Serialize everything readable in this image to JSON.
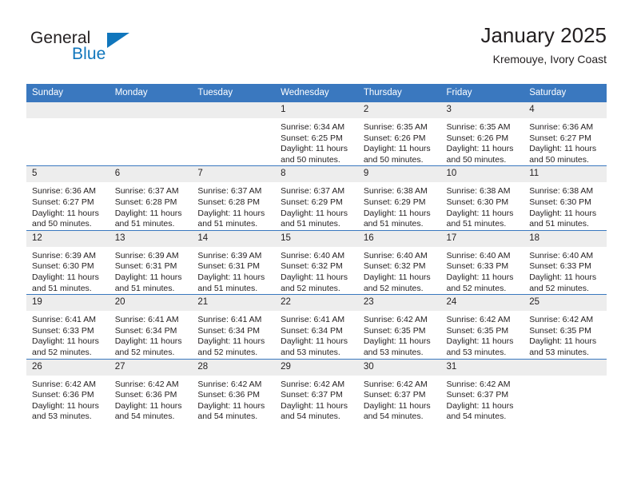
{
  "logo": {
    "word_one": "General",
    "word_two": "Blue",
    "triangle_color": "#1076bc"
  },
  "header": {
    "title": "January 2025",
    "subtitle": "Kremouye, Ivory Coast"
  },
  "theme": {
    "header_blue": "#3a78bf",
    "daynum_gray": "#ededed",
    "text": "#231f20"
  },
  "calendar": {
    "weekday_headers": [
      "Sunday",
      "Monday",
      "Tuesday",
      "Wednesday",
      "Thursday",
      "Friday",
      "Saturday"
    ],
    "labels": {
      "sunrise": "Sunrise:",
      "sunset": "Sunset:",
      "daylight": "Daylight:"
    },
    "weeks": [
      [
        {
          "day": "",
          "empty": true
        },
        {
          "day": "",
          "empty": true
        },
        {
          "day": "",
          "empty": true
        },
        {
          "day": "1",
          "sunrise": "Sunrise: 6:34 AM",
          "sunset": "Sunset: 6:25 PM",
          "daylight": "Daylight: 11 hours and 50 minutes."
        },
        {
          "day": "2",
          "sunrise": "Sunrise: 6:35 AM",
          "sunset": "Sunset: 6:26 PM",
          "daylight": "Daylight: 11 hours and 50 minutes."
        },
        {
          "day": "3",
          "sunrise": "Sunrise: 6:35 AM",
          "sunset": "Sunset: 6:26 PM",
          "daylight": "Daylight: 11 hours and 50 minutes."
        },
        {
          "day": "4",
          "sunrise": "Sunrise: 6:36 AM",
          "sunset": "Sunset: 6:27 PM",
          "daylight": "Daylight: 11 hours and 50 minutes."
        }
      ],
      [
        {
          "day": "5",
          "sunrise": "Sunrise: 6:36 AM",
          "sunset": "Sunset: 6:27 PM",
          "daylight": "Daylight: 11 hours and 50 minutes."
        },
        {
          "day": "6",
          "sunrise": "Sunrise: 6:37 AM",
          "sunset": "Sunset: 6:28 PM",
          "daylight": "Daylight: 11 hours and 51 minutes."
        },
        {
          "day": "7",
          "sunrise": "Sunrise: 6:37 AM",
          "sunset": "Sunset: 6:28 PM",
          "daylight": "Daylight: 11 hours and 51 minutes."
        },
        {
          "day": "8",
          "sunrise": "Sunrise: 6:37 AM",
          "sunset": "Sunset: 6:29 PM",
          "daylight": "Daylight: 11 hours and 51 minutes."
        },
        {
          "day": "9",
          "sunrise": "Sunrise: 6:38 AM",
          "sunset": "Sunset: 6:29 PM",
          "daylight": "Daylight: 11 hours and 51 minutes."
        },
        {
          "day": "10",
          "sunrise": "Sunrise: 6:38 AM",
          "sunset": "Sunset: 6:30 PM",
          "daylight": "Daylight: 11 hours and 51 minutes."
        },
        {
          "day": "11",
          "sunrise": "Sunrise: 6:38 AM",
          "sunset": "Sunset: 6:30 PM",
          "daylight": "Daylight: 11 hours and 51 minutes."
        }
      ],
      [
        {
          "day": "12",
          "sunrise": "Sunrise: 6:39 AM",
          "sunset": "Sunset: 6:30 PM",
          "daylight": "Daylight: 11 hours and 51 minutes."
        },
        {
          "day": "13",
          "sunrise": "Sunrise: 6:39 AM",
          "sunset": "Sunset: 6:31 PM",
          "daylight": "Daylight: 11 hours and 51 minutes."
        },
        {
          "day": "14",
          "sunrise": "Sunrise: 6:39 AM",
          "sunset": "Sunset: 6:31 PM",
          "daylight": "Daylight: 11 hours and 51 minutes."
        },
        {
          "day": "15",
          "sunrise": "Sunrise: 6:40 AM",
          "sunset": "Sunset: 6:32 PM",
          "daylight": "Daylight: 11 hours and 52 minutes."
        },
        {
          "day": "16",
          "sunrise": "Sunrise: 6:40 AM",
          "sunset": "Sunset: 6:32 PM",
          "daylight": "Daylight: 11 hours and 52 minutes."
        },
        {
          "day": "17",
          "sunrise": "Sunrise: 6:40 AM",
          "sunset": "Sunset: 6:33 PM",
          "daylight": "Daylight: 11 hours and 52 minutes."
        },
        {
          "day": "18",
          "sunrise": "Sunrise: 6:40 AM",
          "sunset": "Sunset: 6:33 PM",
          "daylight": "Daylight: 11 hours and 52 minutes."
        }
      ],
      [
        {
          "day": "19",
          "sunrise": "Sunrise: 6:41 AM",
          "sunset": "Sunset: 6:33 PM",
          "daylight": "Daylight: 11 hours and 52 minutes."
        },
        {
          "day": "20",
          "sunrise": "Sunrise: 6:41 AM",
          "sunset": "Sunset: 6:34 PM",
          "daylight": "Daylight: 11 hours and 52 minutes."
        },
        {
          "day": "21",
          "sunrise": "Sunrise: 6:41 AM",
          "sunset": "Sunset: 6:34 PM",
          "daylight": "Daylight: 11 hours and 52 minutes."
        },
        {
          "day": "22",
          "sunrise": "Sunrise: 6:41 AM",
          "sunset": "Sunset: 6:34 PM",
          "daylight": "Daylight: 11 hours and 53 minutes."
        },
        {
          "day": "23",
          "sunrise": "Sunrise: 6:42 AM",
          "sunset": "Sunset: 6:35 PM",
          "daylight": "Daylight: 11 hours and 53 minutes."
        },
        {
          "day": "24",
          "sunrise": "Sunrise: 6:42 AM",
          "sunset": "Sunset: 6:35 PM",
          "daylight": "Daylight: 11 hours and 53 minutes."
        },
        {
          "day": "25",
          "sunrise": "Sunrise: 6:42 AM",
          "sunset": "Sunset: 6:35 PM",
          "daylight": "Daylight: 11 hours and 53 minutes."
        }
      ],
      [
        {
          "day": "26",
          "sunrise": "Sunrise: 6:42 AM",
          "sunset": "Sunset: 6:36 PM",
          "daylight": "Daylight: 11 hours and 53 minutes."
        },
        {
          "day": "27",
          "sunrise": "Sunrise: 6:42 AM",
          "sunset": "Sunset: 6:36 PM",
          "daylight": "Daylight: 11 hours and 54 minutes."
        },
        {
          "day": "28",
          "sunrise": "Sunrise: 6:42 AM",
          "sunset": "Sunset: 6:36 PM",
          "daylight": "Daylight: 11 hours and 54 minutes."
        },
        {
          "day": "29",
          "sunrise": "Sunrise: 6:42 AM",
          "sunset": "Sunset: 6:37 PM",
          "daylight": "Daylight: 11 hours and 54 minutes."
        },
        {
          "day": "30",
          "sunrise": "Sunrise: 6:42 AM",
          "sunset": "Sunset: 6:37 PM",
          "daylight": "Daylight: 11 hours and 54 minutes."
        },
        {
          "day": "31",
          "sunrise": "Sunrise: 6:42 AM",
          "sunset": "Sunset: 6:37 PM",
          "daylight": "Daylight: 11 hours and 54 minutes."
        },
        {
          "day": "",
          "empty": true
        }
      ]
    ]
  }
}
